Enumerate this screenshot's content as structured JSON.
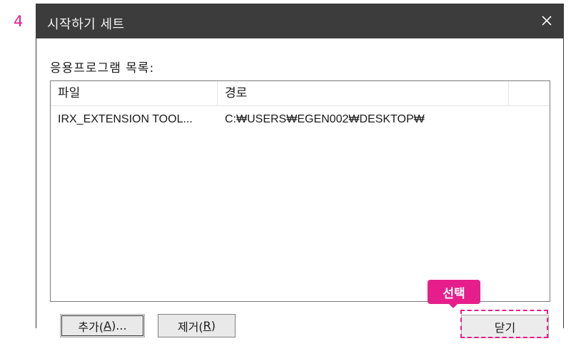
{
  "annotation": {
    "step_number": "4",
    "callout_label": "선택",
    "accent_color": "#e61e8c"
  },
  "window": {
    "title": "시작하기 세트",
    "close_icon": "close-icon"
  },
  "list": {
    "label": "응용프로그램 목록:",
    "columns": [
      "파일",
      "경로",
      ""
    ],
    "rows": [
      {
        "file": "IRX_EXTENSION TOOL...",
        "path": "C:₩USERS₩EGEN002₩DESKTOP₩"
      }
    ]
  },
  "buttons": {
    "add": {
      "text": "추가(",
      "key": "A",
      "suffix": ")..."
    },
    "remove": {
      "text": "제거(",
      "key": "R",
      "suffix": ")"
    },
    "close": "닫기"
  }
}
